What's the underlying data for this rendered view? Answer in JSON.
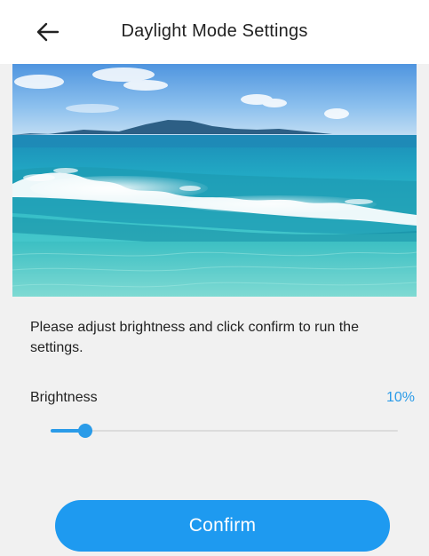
{
  "header": {
    "back_icon": "arrow-left-icon",
    "title": "Daylight Mode Settings"
  },
  "preview": {
    "description_icon": "beach-scene-image"
  },
  "instruction": "Please adjust brightness and click confirm to run the settings.",
  "brightness": {
    "label": "Brightness",
    "value_text": "10%",
    "value_fraction": 0.1
  },
  "confirm_label": "Confirm",
  "colors": {
    "accent": "#1e9af0",
    "value_text": "#2a9be8",
    "background": "#f1f1f1"
  }
}
